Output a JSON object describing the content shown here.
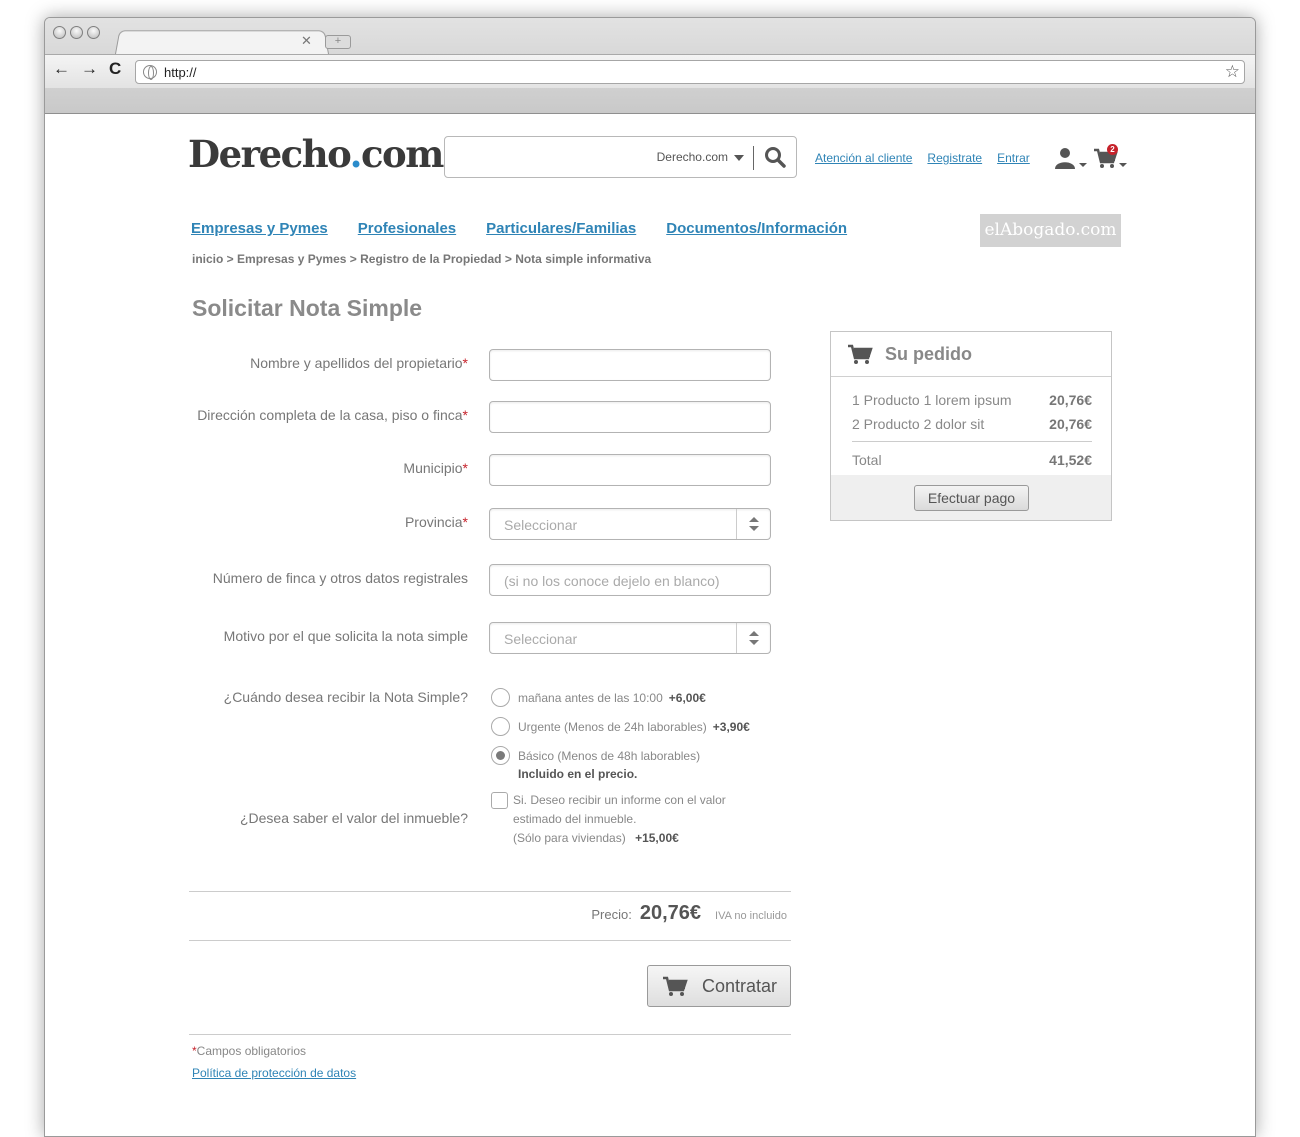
{
  "browser": {
    "url": "http://"
  },
  "header": {
    "logo_main": "Derecho",
    "logo_dot": ".",
    "logo_tld": "com",
    "search_scope": "Derecho.com",
    "links": [
      "Atención al cliente",
      "Registrate",
      "Entrar"
    ],
    "cart_count": "2"
  },
  "nav": {
    "items": [
      "Empresas y Pymes",
      "Profesionales",
      "Particulares/Familias",
      "Documentos/Información"
    ],
    "partner_badge": "elAbogado.com"
  },
  "breadcrumb": [
    "inicio",
    " > ",
    "Empresas y Pymes",
    " > ",
    "Registro de la Propiedad",
    " > ",
    "Nota simple informativa"
  ],
  "form": {
    "title": "Solicitar Nota Simple",
    "required_mark": "*",
    "fields": {
      "owner_label": "Nombre y apellidos del propietario",
      "address_label": "Dirección completa de la casa, piso o finca",
      "municipality_label": "Municipio",
      "province_label": "Provincia",
      "province_value": "Seleccionar",
      "registry_label": "Número de finca y otros datos registrales",
      "registry_placeholder": "(si no los conoce dejelo en blanco)",
      "reason_label": "Motivo por el que solicita la nota simple",
      "reason_value": "Seleccionar"
    },
    "delivery": {
      "label": "¿Cuándo desea recibir la Nota Simple?",
      "options": [
        {
          "text": "mañana antes de las 10:00",
          "extra": "+6,00€"
        },
        {
          "text": "Urgente (Menos de 24h laborables)",
          "extra": "+3,90€"
        },
        {
          "text": "Básico (Menos de 48h laborables)",
          "extra": ""
        }
      ],
      "selected_index": 2,
      "included_note": "Incluido en el precio."
    },
    "valuation": {
      "label": "¿Desea saber el valor del inmueble?",
      "line1": "Si. Deseo recibir un informe con el valor",
      "line2": "estimado del inmueble.",
      "line3": "(Sólo para viviendas)",
      "extra": "+15,00€"
    },
    "price": {
      "label": "Precio:",
      "value": "20,76€",
      "tax_note": "IVA no incluido"
    },
    "submit_label": "Contratar",
    "footnote": "Campos obligatorios",
    "policy_link": "Política de protección de datos"
  },
  "order": {
    "title": "Su pedido",
    "items": [
      {
        "name": "1 Producto 1 lorem ipsum",
        "price": "20,76€"
      },
      {
        "name": "2 Producto 2 dolor sit",
        "price": "20,76€"
      }
    ],
    "total_label": "Total",
    "total_value": "41,52€",
    "pay_label": "Efectuar pago"
  },
  "colors": {
    "accent": "#2f84b6",
    "required": "#c6222b"
  }
}
